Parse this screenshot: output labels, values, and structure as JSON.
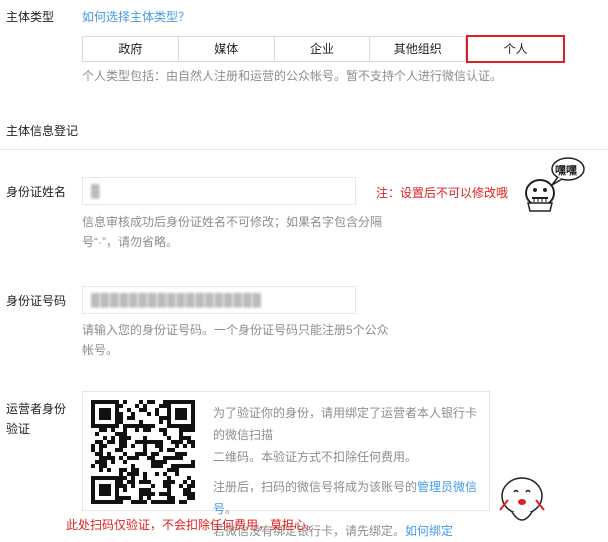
{
  "subject_type": {
    "label": "主体类型",
    "help_link": "如何选择主体类型？",
    "tabs": [
      "政府",
      "媒体",
      "企业",
      "其他组织",
      "个人"
    ],
    "active_tab": "个人",
    "hint": "个人类型包括：由自然人注册和运营的公众帐号。暂不支持个人进行微信认证。"
  },
  "registration": {
    "section_title": "主体信息登记",
    "name": {
      "label": "身份证姓名",
      "value": "█",
      "hint_line1": "信息审核成功后身份证姓名不可修改；如果名字包含分隔",
      "hint_line2": "号“·”，请勿省略。",
      "annotation": "注：设置后不可以修改哦"
    },
    "id_number": {
      "label": "身份证号码",
      "value": "██████████████████",
      "hint_line1": "请输入您的身份证号码。一个身份证号码只能注册5个公众",
      "hint_line2": "帐号。"
    },
    "operator": {
      "label_line1": "运营者身份",
      "label_line2": "验证",
      "text_line1": "为了验证你的身份，请用绑定了运营者本人银行卡的微信扫描",
      "text_line2": "二维码。本验证方式不扣除任何费用。",
      "text_line3_prefix": "注册后，扫码的微信号将成为该账号的",
      "text_line3_link": "管理员微信号",
      "text_line3_suffix": "。",
      "text_line4_prefix": "若微信没有绑定银行卡，请先绑定。",
      "text_line4_link": "如何绑定",
      "annotation": "此处扫码仅验证，不会扣除任何费用，莫担心。"
    }
  },
  "sticker_top": {
    "bubble_text": "嘿嘿"
  },
  "colors": {
    "accent": "#459ae9",
    "annotation": "#e02020",
    "hint": "#8d8d8d",
    "border": "#e7e7eb"
  }
}
